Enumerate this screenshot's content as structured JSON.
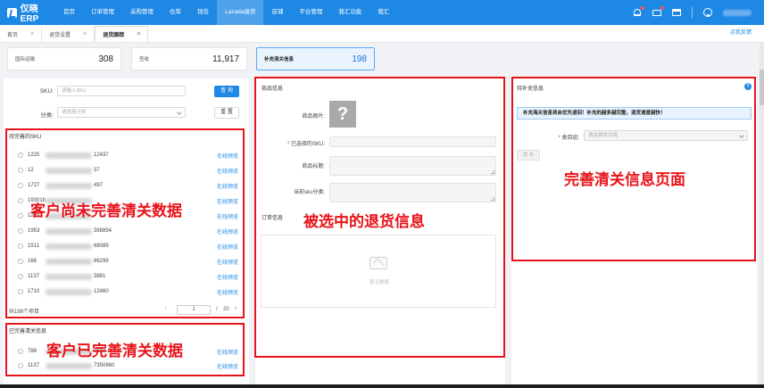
{
  "app": {
    "title": "仅晓ERP"
  },
  "nav": {
    "items": [
      "首页",
      "订单管理",
      "采购管理",
      "仓库",
      "钱包",
      "Lazada退货",
      "店铺",
      "平台管理",
      "我汇功能",
      "我汇"
    ],
    "active_index": 5
  },
  "tabs": [
    {
      "label": "首页",
      "active": false
    },
    {
      "label": "退货设置",
      "active": false
    },
    {
      "label": "退货跟踪",
      "active": true
    }
  ],
  "feedback_link": "点我反馈",
  "stats": [
    {
      "label": "国际运输",
      "value": "308"
    },
    {
      "label": "签收",
      "value": "11,917"
    },
    {
      "label": "补充清关信息",
      "value": "198"
    }
  ],
  "filters": {
    "sku_label": "SKU:",
    "sku_placeholder": "请输入SKU",
    "category_label": "分类:",
    "category_placeholder": "请选择分类",
    "search_button": "查 询",
    "reset_button": "重 置"
  },
  "pending": {
    "title": "待完善的SKU",
    "link_label": "在线预览",
    "rows": [
      {
        "prefix": "1225",
        "suffix": "12437"
      },
      {
        "prefix": "12",
        "suffix": "37"
      },
      {
        "prefix": "1727",
        "suffix": "497"
      },
      {
        "prefix": "193018",
        "suffix": ""
      },
      {
        "prefix": "1245",
        "suffix": ""
      },
      {
        "prefix": "1953",
        "suffix": "368854"
      },
      {
        "prefix": "1511",
        "suffix": "68089"
      },
      {
        "prefix": "168",
        "suffix": "86299"
      },
      {
        "prefix": "1137",
        "suffix": "3881"
      },
      {
        "prefix": "1710",
        "suffix": "12460"
      }
    ],
    "total_text": "共198个项目",
    "current_page": "1",
    "total_pages": "20"
  },
  "completed": {
    "title": "已完善清关信息",
    "link_label": "在线预览",
    "rows": [
      {
        "prefix": "788",
        "suffix": "0618"
      },
      {
        "prefix": "1137",
        "suffix": "7350860"
      }
    ]
  },
  "product_panel": {
    "title": "商品信息",
    "image_label": "商品图片:",
    "image_glyph": "?",
    "sku_label": "已选择的SKU:",
    "title_label": "商品标题:",
    "category_label": "当前sku分类:",
    "empty_dash": "--"
  },
  "order_panel": {
    "title": "订单信息",
    "empty_text": "暂无数据"
  },
  "supplement_panel": {
    "title": "待补充信息",
    "help_glyph": "?",
    "alert": "补充海关信息将会优先退回！补充的越多越完整，退货速度越快！",
    "category_label": "类目组:",
    "category_placeholder": "请选择类目组",
    "save_button": "保 存"
  },
  "annotations": {
    "pending": "客户尚未完善清关数据",
    "completed": "客户已完善清关数据",
    "selected": "被选中的退货信息",
    "complete_page": "完善清关信息页面"
  },
  "colors": {
    "primary": "#1e88e5",
    "annotation_red": "#e8131a"
  }
}
